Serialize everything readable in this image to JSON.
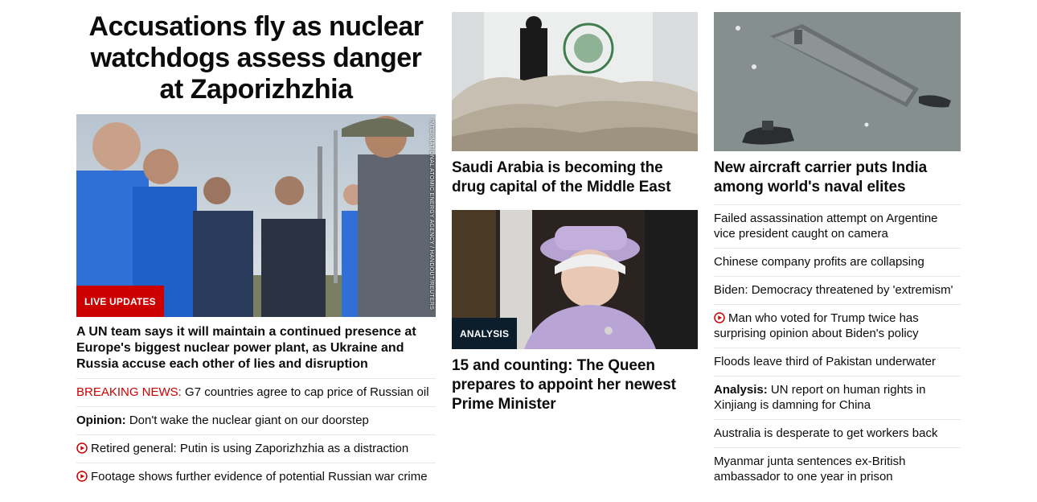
{
  "col1": {
    "headline": "Accusations fly as nuclear watchdogs assess danger at Zaporizhzhia",
    "image_credit": "INTERNATIONAL ATOMIC ENERGY AGENCY / HANDOUT/REUTERS",
    "badge": "LIVE UPDATES",
    "lead": "A UN team says it will maintain a continued presence at Europe's biggest nuclear power plant, as Ukraine and Russia accuse each other of lies and disruption",
    "items": [
      {
        "prefix": "BREAKING NEWS:",
        "text": " G7 countries agree to cap price of Russian oil"
      },
      {
        "prefix": "Opinion:",
        "text": " Don't wake the nuclear giant on our doorstep"
      },
      {
        "text": "Retired general: Putin is using Zaporizhzhia as a distraction",
        "icon": "play-icon"
      },
      {
        "text": "Footage shows further evidence of potential Russian war crime",
        "icon": "play-icon"
      }
    ]
  },
  "col2": {
    "card1_title": "Saudi Arabia is becoming the drug capital of the Middle East",
    "card2_badge": "ANALYSIS",
    "card2_title": "15 and counting: The Queen prepares to appoint her newest Prime Minister"
  },
  "col3": {
    "card_title": "New aircraft carrier puts India among world's naval elites",
    "items": [
      {
        "text": "Failed assassination attempt on Argentine vice president caught on camera"
      },
      {
        "text": "Chinese company profits are collapsing"
      },
      {
        "text": "Biden: Democracy threatened by 'extremism'"
      },
      {
        "text": "Man who voted for Trump twice has surprising opinion about Biden's policy",
        "icon": "play-icon"
      },
      {
        "text": "Floods leave third of Pakistan underwater"
      },
      {
        "prefix": "Analysis:",
        "text": " UN report on human rights in Xinjiang is damning for China"
      },
      {
        "text": "Australia is desperate to get workers back"
      },
      {
        "text": "Myanmar junta sentences ex-British ambassador to one year in prison"
      }
    ]
  },
  "colors": {
    "accent_red": "#cc0000",
    "analysis_badge": "#0c1d2b",
    "divider": "#e6e6e6"
  }
}
